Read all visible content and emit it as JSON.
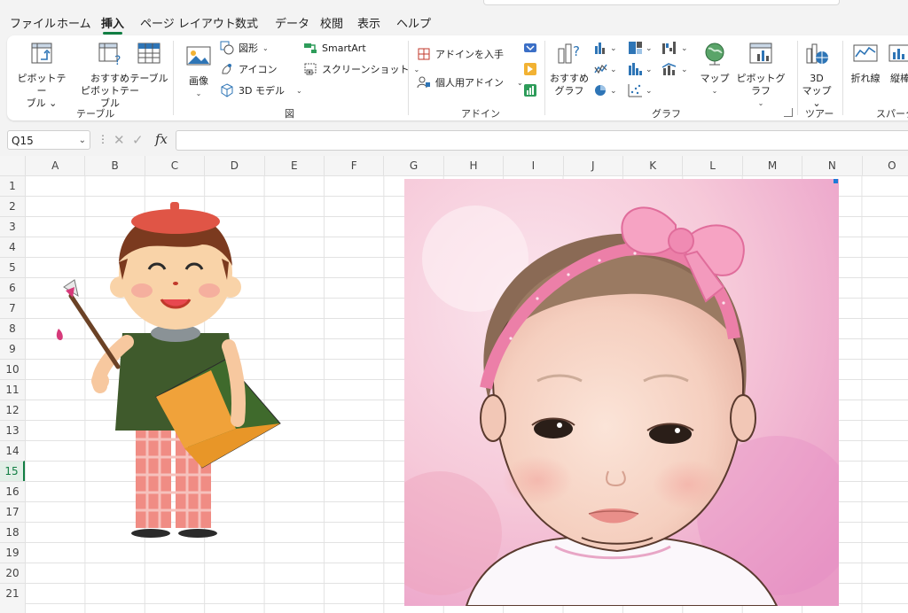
{
  "menu": {
    "tabs": [
      "ファイル",
      "ホーム",
      "挿入",
      "ページ レイアウト",
      "数式",
      "データ",
      "校閲",
      "表示",
      "ヘルプ"
    ],
    "active": "挿入"
  },
  "ribbon": {
    "table_group": {
      "label": "テーブル",
      "pivot_table": [
        "ピボットテー",
        "ブル ⌄"
      ],
      "recommended_pivot": [
        "おすすめ",
        "ピボットテーブル"
      ],
      "table": "テーブル"
    },
    "illustrations_group": {
      "label": "図",
      "image": "画像",
      "shapes": "図形",
      "icons": "アイコン",
      "models_3d": "3D モデル",
      "smartart": "SmartArt",
      "screenshot": "スクリーンショット"
    },
    "addins_group": {
      "label": "アドイン",
      "get_addins": "アドインを入手",
      "my_addins": "個人用アドイン"
    },
    "charts_group": {
      "label": "グラフ",
      "recommended_charts": [
        "おすすめ",
        "グラフ"
      ],
      "maps": "マップ",
      "pivot_chart": "ピボットグラフ"
    },
    "tours_group": {
      "label": "ツアー",
      "map_3d": [
        "3D",
        "マップ ⌄"
      ]
    },
    "sparklines_group": {
      "label": "スパーク",
      "line": "折れ線",
      "column": "縦棒"
    }
  },
  "formula_bar": {
    "name_box": "Q15",
    "formula": ""
  },
  "sheet": {
    "columns": [
      "A",
      "B",
      "C",
      "D",
      "E",
      "F",
      "G",
      "H",
      "I",
      "J",
      "K",
      "L",
      "M",
      "N",
      "O"
    ],
    "rows": [
      "1",
      "2",
      "3",
      "4",
      "5",
      "6",
      "7",
      "8",
      "9",
      "10",
      "11",
      "12",
      "13",
      "14",
      "15",
      "16",
      "17",
      "18",
      "19",
      "20",
      "21"
    ],
    "selected_row": "15"
  },
  "colors": {
    "accent": "#117e43",
    "ribbon_bg": "#ffffff"
  }
}
